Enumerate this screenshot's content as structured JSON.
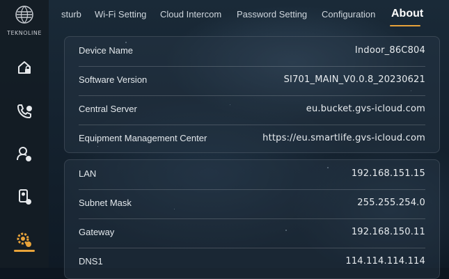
{
  "sidebar": {
    "logo_text": "TEKNOLINE",
    "items": [
      {
        "icon": "home-lock-icon"
      },
      {
        "icon": "phone-call-icon"
      },
      {
        "icon": "user-settings-icon"
      },
      {
        "icon": "contact-card-icon"
      },
      {
        "icon": "settings-gear-icon",
        "active": true
      }
    ],
    "accent_color": "#e8a33a"
  },
  "tabs": {
    "items": [
      {
        "label": "sturb"
      },
      {
        "label": "Wi-Fi Setting"
      },
      {
        "label": "Cloud Intercom"
      },
      {
        "label": "Password Setting"
      },
      {
        "label": "Configuration"
      },
      {
        "label": "About",
        "active": true
      }
    ]
  },
  "device_panel": {
    "rows": [
      {
        "label": "Device Name",
        "value": "Indoor_86C804"
      },
      {
        "label": "Software Version",
        "value": "SI701_MAIN_V0.0.8_20230621"
      },
      {
        "label": "Central Server",
        "value": "eu.bucket.gvs-icloud.com"
      },
      {
        "label": "Equipment Management Center",
        "value": "https://eu.smartlife.gvs-icloud.com"
      }
    ]
  },
  "network_panel": {
    "rows": [
      {
        "label": "LAN",
        "value": "192.168.151.15"
      },
      {
        "label": "Subnet Mask",
        "value": "255.255.254.0"
      },
      {
        "label": "Gateway",
        "value": "192.168.150.11"
      },
      {
        "label": "DNS1",
        "value": "114.114.114.114"
      }
    ]
  }
}
